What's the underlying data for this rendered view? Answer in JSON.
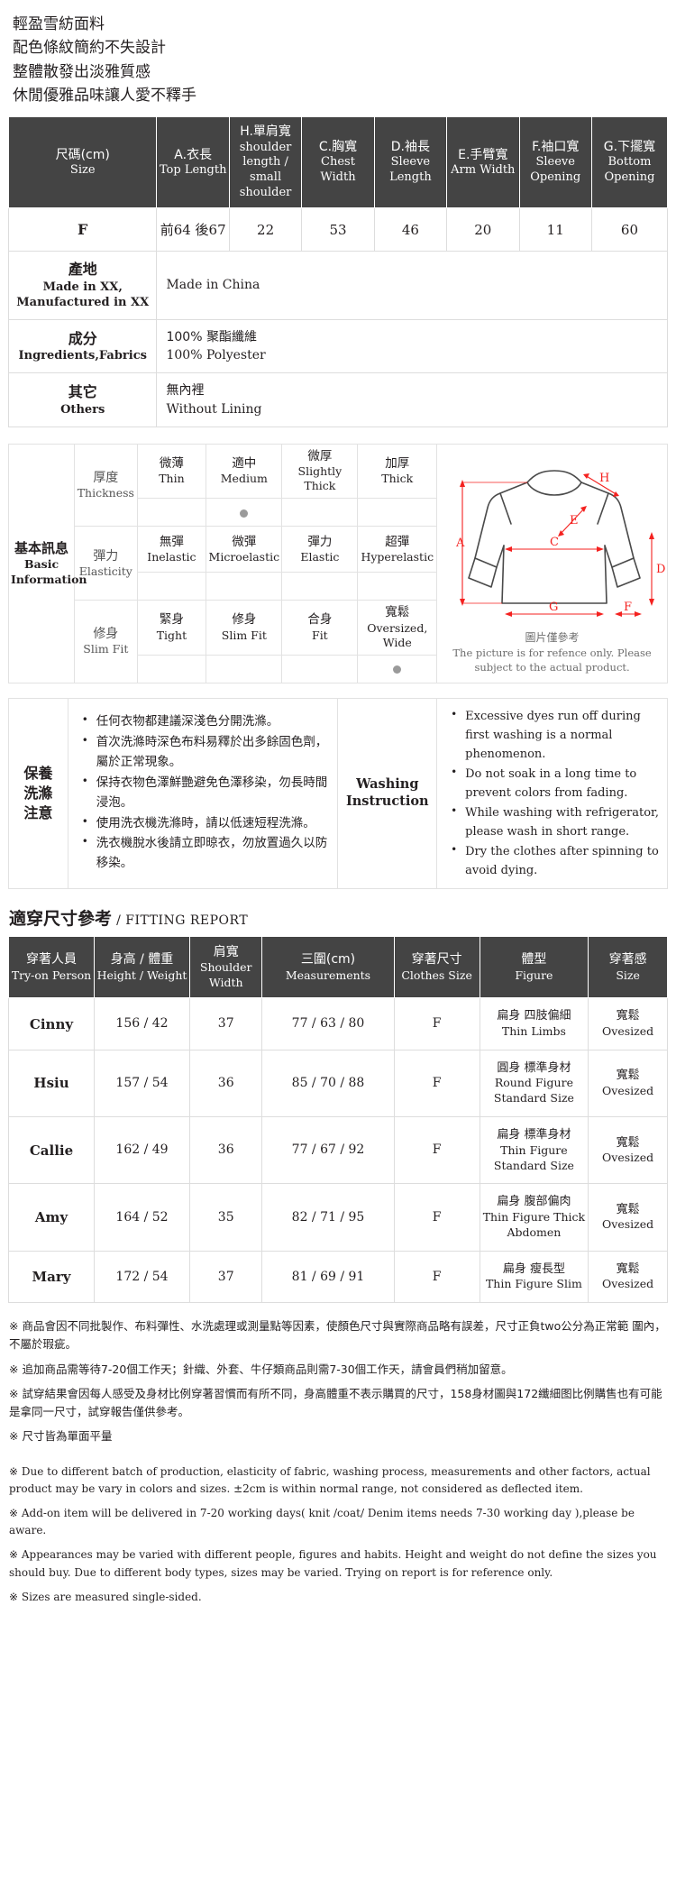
{
  "intro": {
    "lines": [
      "輕盈雪紡面料",
      "配色條紋簡約不失設計",
      "整體散發出淡雅質感",
      "休閒優雅品味讓人愛不釋手"
    ]
  },
  "size_table": {
    "headers": [
      {
        "cn": "尺碼(cm)",
        "en": "Size"
      },
      {
        "cn": "A.衣長",
        "en": "Top Length"
      },
      {
        "cn": "H.單肩寬",
        "en": "shoulder length / small shoulder"
      },
      {
        "cn": "C.胸寬",
        "en": "Chest Width"
      },
      {
        "cn": "D.袖長",
        "en": "Sleeve Length"
      },
      {
        "cn": "E.手臂寬",
        "en": "Arm Width"
      },
      {
        "cn": "F.袖口寬",
        "en": "Sleeve Opening"
      },
      {
        "cn": "G.下擺寬",
        "en": "Bottom Opening"
      }
    ],
    "rows": [
      {
        "size": "F",
        "values": [
          "前64 後67",
          "22",
          "53",
          "46",
          "20",
          "11",
          "60"
        ]
      }
    ],
    "info_rows": [
      {
        "label_cn": "產地",
        "label_en": "Made in XX, Manufactured in XX",
        "value_cn": "Made in China",
        "value_en": ""
      },
      {
        "label_cn": "成分",
        "label_en": "Ingredients,Fabrics",
        "value_cn": "100% 聚酯纖維",
        "value_en": "100% Polyester"
      },
      {
        "label_cn": "其它",
        "label_en": "Others",
        "value_cn": "無內裡",
        "value_en": "Without Lining"
      }
    ]
  },
  "basic_info": {
    "label_cn": "基本訊息",
    "label_en_1": "Basic",
    "label_en_2": "Information",
    "rows": [
      {
        "name_cn": "厚度",
        "name_en": "Thickness",
        "options": [
          {
            "cn": "微薄",
            "en": "Thin"
          },
          {
            "cn": "適中",
            "en": "Medium"
          },
          {
            "cn": "微厚",
            "en": "Slightly Thick"
          },
          {
            "cn": "加厚",
            "en": "Thick"
          }
        ],
        "selected": 1
      },
      {
        "name_cn": "彈力",
        "name_en": "Elasticity",
        "options": [
          {
            "cn": "無彈",
            "en": "Inelastic"
          },
          {
            "cn": "微彈",
            "en": "Microelastic"
          },
          {
            "cn": "彈力",
            "en": "Elastic"
          },
          {
            "cn": "超彈",
            "en": "Hyperelastic"
          }
        ],
        "selected": -1
      },
      {
        "name_cn": "修身",
        "name_en": "Slim Fit",
        "options": [
          {
            "cn": "緊身",
            "en": "Tight"
          },
          {
            "cn": "修身",
            "en": "Slim Fit"
          },
          {
            "cn": "合身",
            "en": "Fit"
          },
          {
            "cn": "寬鬆",
            "en": "Oversized, Wide"
          }
        ],
        "selected": 3
      }
    ],
    "diagram": {
      "labels": [
        "A",
        "C",
        "D",
        "E",
        "F",
        "G",
        "H"
      ],
      "caption_cn": "圖片僅參考",
      "caption_en": "The picture is for refence only. Please subject to the actual product."
    }
  },
  "washing": {
    "label_cn_lines": [
      "保養",
      "洗滌",
      "注意"
    ],
    "label_en_lines": [
      "Washing",
      "Instruction"
    ],
    "notes_cn": [
      "任何衣物都建議深淺色分開洗滌。",
      "首次洗滌時深色布料易釋於出多餘固色劑，屬於正常現象。",
      "保持衣物色澤鮮艷避免色澤移染，勿長時間浸泡。",
      "使用洗衣機洗滌時，請以低速短程洗滌。",
      "洗衣機脫水後請立即晾衣，勿放置過久以防移染。"
    ],
    "notes_en": [
      "Excessive dyes run off during first washing is a normal phenomenon.",
      "Do not soak in a long time to prevent colors from fading.",
      "While washing with refrigerator, please wash in short range.",
      "Dry the clothes after spinning to avoid dying."
    ]
  },
  "fitting_report": {
    "title_cn": "適穿尺寸參考",
    "title_en": "/ FITTING REPORT",
    "headers": [
      {
        "cn": "穿著人員",
        "en": "Try-on Person"
      },
      {
        "cn": "身高 / 體重",
        "en": "Height / Weight"
      },
      {
        "cn": "肩寬",
        "en": "Shoulder Width"
      },
      {
        "cn": "三圍(cm)",
        "en": "Measurements"
      },
      {
        "cn": "穿著尺寸",
        "en": "Clothes Size"
      },
      {
        "cn": "體型",
        "en": "Figure"
      },
      {
        "cn": "穿著感",
        "en": "Size"
      }
    ],
    "rows": [
      {
        "person": "Cinny",
        "height_weight": "156 / 42",
        "shoulder": "37",
        "measurements": "77 / 63 / 80",
        "size": "F",
        "figure_cn": "扁身 四肢偏細",
        "figure_en": "Thin Limbs",
        "feel_cn": "寬鬆",
        "feel_en": "Ovesized"
      },
      {
        "person": "Hsiu",
        "height_weight": "157 / 54",
        "shoulder": "36",
        "measurements": "85 / 70 / 88",
        "size": "F",
        "figure_cn": "圓身 標準身材",
        "figure_en": "Round Figure Standard Size",
        "feel_cn": "寬鬆",
        "feel_en": "Ovesized"
      },
      {
        "person": "Callie",
        "height_weight": "162 / 49",
        "shoulder": "36",
        "measurements": "77 / 67 / 92",
        "size": "F",
        "figure_cn": "扁身 標準身材",
        "figure_en": "Thin Figure Standard Size",
        "feel_cn": "寬鬆",
        "feel_en": "Ovesized"
      },
      {
        "person": "Amy",
        "height_weight": "164 / 52",
        "shoulder": "35",
        "measurements": "82 / 71 / 95",
        "size": "F",
        "figure_cn": "扁身 腹部偏肉",
        "figure_en": "Thin Figure Thick Abdomen",
        "feel_cn": "寬鬆",
        "feel_en": "Ovesized"
      },
      {
        "person": "Mary",
        "height_weight": "172 / 54",
        "shoulder": "37",
        "measurements": "81 / 69 / 91",
        "size": "F",
        "figure_cn": "扁身 瘦長型",
        "figure_en": "Thin Figure Slim",
        "feel_cn": "寬鬆",
        "feel_en": "Ovesized"
      }
    ]
  },
  "footnotes": {
    "cn": [
      "※ 商品會因不同批製作、布料彈性、水洗處理或測量點等因素，使顏色尺寸與實際商品略有誤差，尺寸正負two公分為正常範 圍內，不屬於瑕疵。",
      "※ 追加商品需等待7-20個工作天；針織、外套、牛仔類商品則需7-30個工作天，請會員們稍加留意。",
      "※ 試穿結果會因每人感受及身材比例穿著習慣而有所不同，身高體重不表示購買的尺寸，158身材圖與172纖細图比例購售也有可能是拿同一尺寸，試穿報告僅供參考。",
      "※ 尺寸皆為單面平量"
    ],
    "en": [
      "※ Due to different batch of production, elasticity of fabric, washing process, measurements and other factors, actual product may be vary in colors and sizes. ±2cm is within normal range, not considered as deflected item.",
      "※ Add-on item will be delivered in 7-20 working days( knit /coat/ Denim items needs 7-30 working day ),please be aware.",
      "※ Appearances may be varied with different people, figures and habits. Height and weight do not define the sizes you should buy. Due to different body types, sizes may be varied. Trying on report is for reference only.",
      "※ Sizes are measured single-sided."
    ]
  }
}
